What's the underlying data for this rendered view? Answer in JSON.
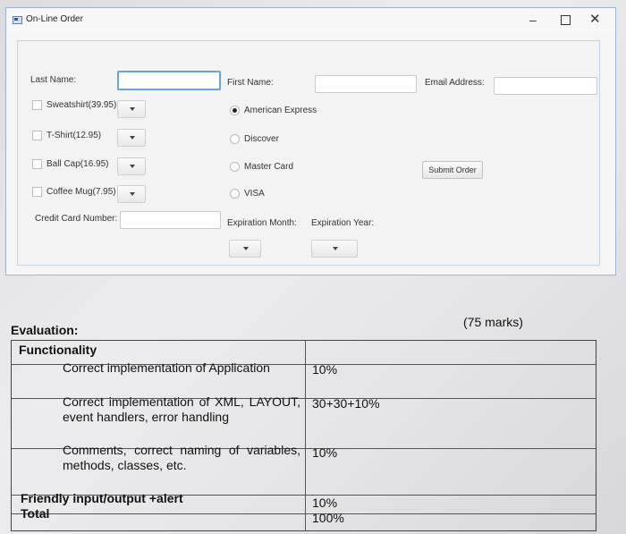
{
  "window": {
    "title": "On-Line Order",
    "controls": {
      "minimize": "–",
      "maximize": "",
      "close": "✕"
    }
  },
  "form": {
    "last_name_label": "Last Name:",
    "first_name_label": "First Name:",
    "email_label": "Email Address:",
    "last_name_value": "",
    "first_name_value": "",
    "email_value": "",
    "products": [
      {
        "label": "Sweatshirt(39.95)"
      },
      {
        "label": "T-Shirt(12.95)"
      },
      {
        "label": "Ball Cap(16.95)"
      },
      {
        "label": "Coffee Mug(7.95)"
      }
    ],
    "payment_options": [
      {
        "label": "American Express",
        "selected": true
      },
      {
        "label": "Discover",
        "selected": false
      },
      {
        "label": "Master Card",
        "selected": false
      },
      {
        "label": "VISA",
        "selected": false
      }
    ],
    "submit_label": "Submit Order",
    "credit_card_label": "Credit Card Number:",
    "credit_card_value": "",
    "expiration_month_label": "Expiration Month:",
    "expiration_year_label": "Expiration Year:"
  },
  "evaluation": {
    "title": "Evaluation:",
    "marks": "(75 marks)",
    "functionality_header": "Functionality",
    "rows": [
      {
        "description": "Correct implementation of Application",
        "value": "10%"
      },
      {
        "description": "Correct implementation of XML, LAYOUT, event handlers, error handling",
        "value": "30+30+10%"
      },
      {
        "description": "Comments, correct naming of variables, methods, classes, etc.",
        "value": "10%"
      }
    ],
    "friendly": {
      "label": "Friendly input/output +alert",
      "value": "10%"
    },
    "total": {
      "label": "Total",
      "value": "100%"
    }
  }
}
